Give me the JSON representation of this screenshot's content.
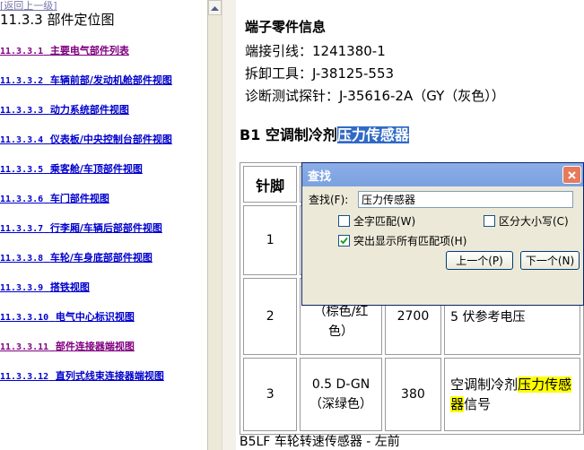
{
  "nav": {
    "back_link": "[返回上一级]",
    "section_title": "11.3.3 部件定位图",
    "links": [
      {
        "num": "11.3.3.1",
        "text": "主要电气部件列表",
        "visited": true
      },
      {
        "num": "11.3.3.2",
        "text": "车辆前部/发动机舱部件视图",
        "visited": false
      },
      {
        "num": "11.3.3.3",
        "text": "动力系统部件视图",
        "visited": false
      },
      {
        "num": "11.3.3.4",
        "text": "仪表板/中央控制台部件视图",
        "visited": false
      },
      {
        "num": "11.3.3.5",
        "text": "乘客舱/车顶部件视图",
        "visited": false
      },
      {
        "num": "11.3.3.6",
        "text": "车门部件视图",
        "visited": false
      },
      {
        "num": "11.3.3.7",
        "text": "行李厢/车辆后部部件视图",
        "visited": false
      },
      {
        "num": "11.3.3.8",
        "text": "车轮/车身底部部件视图",
        "visited": false
      },
      {
        "num": "11.3.3.9",
        "text": "搭铁视图",
        "visited": false
      },
      {
        "num": "11.3.3.10",
        "text": "电气中心标识视图",
        "visited": false
      },
      {
        "num": "11.3.3.11",
        "text": "部件连接器端视图",
        "visited": true
      },
      {
        "num": "11.3.3.12",
        "text": "直列式线束连接器端视图",
        "visited": false
      }
    ]
  },
  "content": {
    "terminal_heading": "端子零件信息",
    "terminal_lead": "端接引线：1241380-1",
    "removal_tool": "拆卸工具：J-38125-553",
    "probe": "诊断测试探针：J-35616-2A（GY（灰色））",
    "section_prefix": "B1 空调制冷剂",
    "section_highlight": "压力传感器",
    "table_header_pin": "针脚",
    "rows": [
      {
        "pin": "1",
        "wire": "",
        "circuit": "",
        "function": ""
      },
      {
        "pin": "2",
        "wire": "（棕色/红色）",
        "circuit": "2700",
        "function": "5 伏参考电压"
      },
      {
        "pin": "3",
        "wire_a": "0.5 D-GN",
        "wire_b": "（深绿色）",
        "circuit": "380",
        "function_prefix": "空调制冷剂",
        "function_hl1": "压力传感",
        "function_hl2": "器",
        "function_suffix": "信号"
      }
    ],
    "bottom_title": "B5LF 车轮转速传感器 - 左前"
  },
  "find_dialog": {
    "title": "查找",
    "find_label": "查找(F):",
    "find_value": "压力传感器",
    "whole_word": "全字匹配(W)",
    "match_case": "区分大小写(C)",
    "highlight_all": "突出显示所有匹配项(H)",
    "prev_button": "上一个(P)",
    "next_button": "下一个(N)",
    "whole_word_checked": false,
    "match_case_checked": false,
    "highlight_all_checked": true
  },
  "colors": {
    "link_blue": "#0000cc",
    "link_visited": "#800080",
    "selection": "#316ac5",
    "match_highlight": "#ffff00"
  }
}
